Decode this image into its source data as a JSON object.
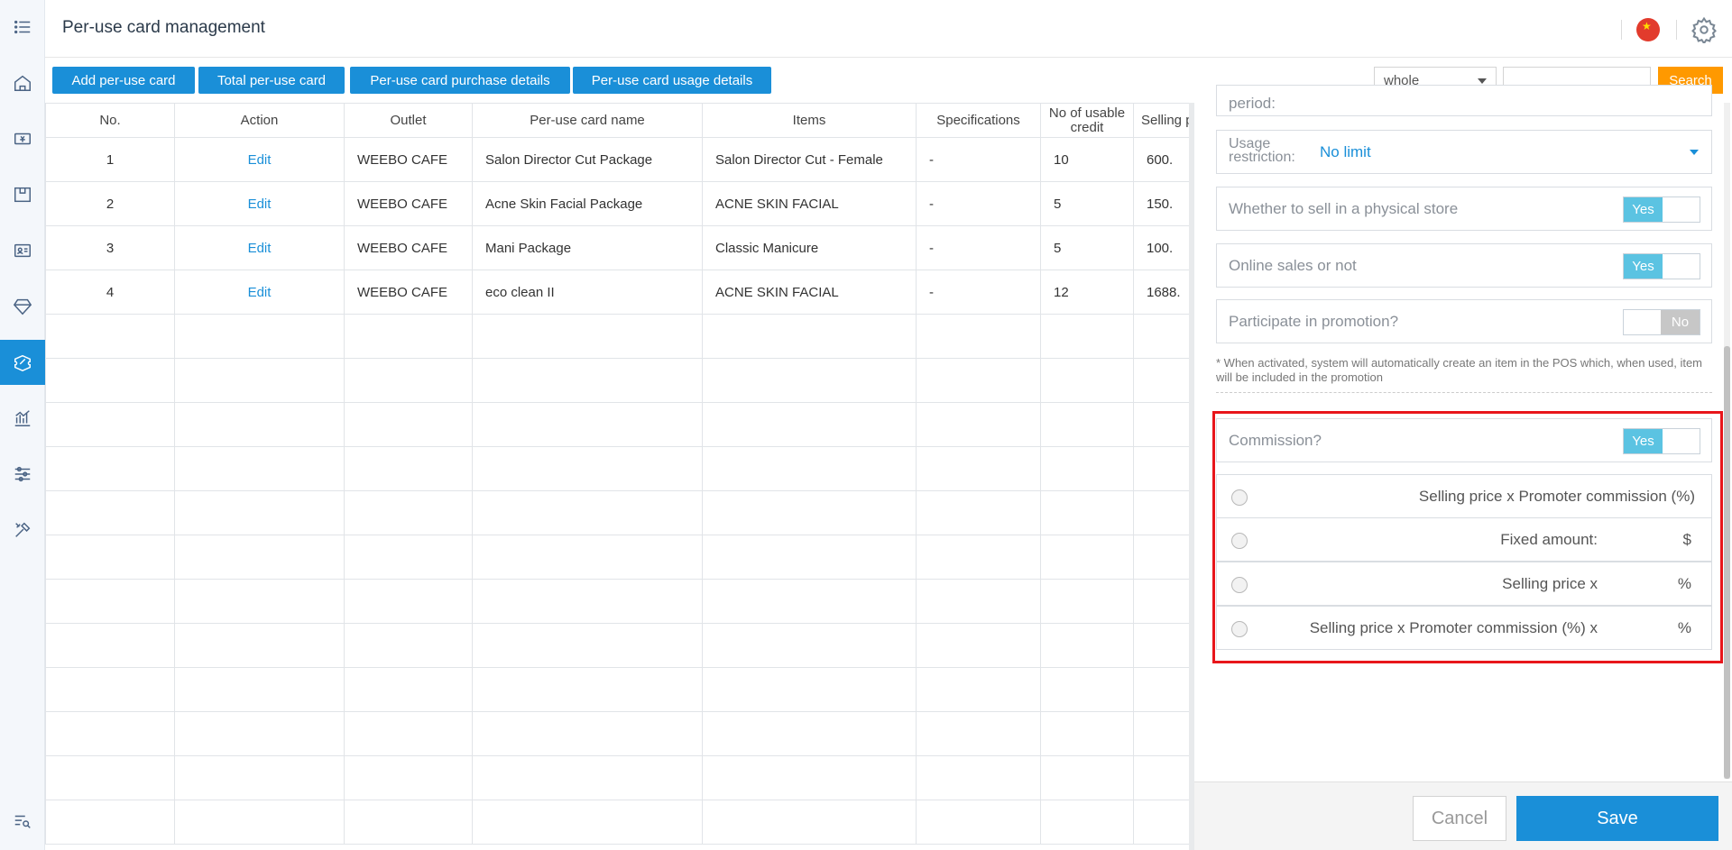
{
  "header": {
    "title": "Per-use card management"
  },
  "toolbar": {
    "add_label": "Add per-use card",
    "total_label": "Total per-use card",
    "purchase_label": "Per-use card purchase details",
    "usage_label": "Per-use card usage details",
    "filter_value": "whole",
    "search_label": "Search"
  },
  "table": {
    "columns": [
      "No.",
      "Action",
      "Outlet",
      "Per-use card name",
      "Items",
      "Specifications",
      "No of usable credit",
      "Selling p"
    ],
    "rows": [
      {
        "no": "1",
        "action": "Edit",
        "outlet": "WEEBO CAFE",
        "name": "Salon Director Cut Package",
        "items": "Salon Director Cut - Female",
        "spec": "-",
        "credit": "10",
        "price": "600."
      },
      {
        "no": "2",
        "action": "Edit",
        "outlet": "WEEBO CAFE",
        "name": "Acne Skin Facial Package",
        "items": "ACNE SKIN FACIAL",
        "spec": "-",
        "credit": "5",
        "price": "150."
      },
      {
        "no": "3",
        "action": "Edit",
        "outlet": "WEEBO CAFE",
        "name": "Mani Package",
        "items": "Classic Manicure",
        "spec": "-",
        "credit": "5",
        "price": "100."
      },
      {
        "no": "4",
        "action": "Edit",
        "outlet": "WEEBO CAFE",
        "name": "eco clean II",
        "items": "ACNE SKIN FACIAL",
        "spec": "-",
        "credit": "12",
        "price": "1688."
      }
    ]
  },
  "panel": {
    "period_label": "period:",
    "usage_restriction_label": "Usage restriction:",
    "usage_restriction_value": "No limit",
    "physical_store_label": "Whether to sell in a physical store",
    "physical_store_value": "Yes",
    "online_label": "Online sales or not",
    "online_value": "Yes",
    "promotion_label": "Participate in promotion?",
    "promotion_value": "No",
    "promotion_note": "* When activated, system will automatically create an item in the POS which, when used, item will be included in the promotion",
    "commission_label": "Commission?",
    "commission_value": "Yes",
    "commission_options": [
      {
        "text": "Selling price x Promoter commission (%)",
        "unit": ""
      },
      {
        "text": "Fixed amount:",
        "unit": "$"
      },
      {
        "text": "Selling price x",
        "unit": "%"
      },
      {
        "text": "Selling price x Promoter commission (%) x",
        "unit": "%"
      }
    ],
    "cancel_label": "Cancel",
    "save_label": "Save"
  },
  "colors": {
    "primary": "#1a8fd8",
    "search": "#ff9900",
    "toggle_on": "#5bc3e2",
    "toggle_off": "#c7c7c7",
    "highlight": "#e8161b"
  }
}
